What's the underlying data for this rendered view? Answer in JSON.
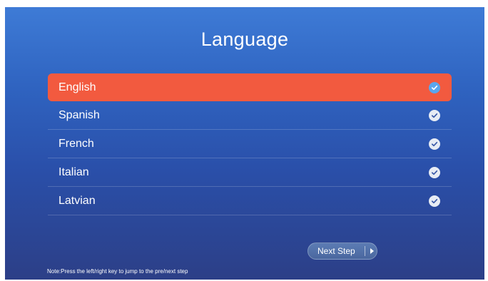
{
  "screen": {
    "title": "Language",
    "languages": [
      {
        "label": "English",
        "selected": true
      },
      {
        "label": "Spanish",
        "selected": false
      },
      {
        "label": "French",
        "selected": false
      },
      {
        "label": "Italian",
        "selected": false
      },
      {
        "label": "Latvian",
        "selected": false
      }
    ],
    "next_button_label": "Next Step",
    "note": "Note:Press the left/right key to jump to the pre/next step"
  },
  "icons": {
    "check": "check-circle-icon",
    "next": "play-arrow-icon"
  },
  "colors": {
    "selected_row": "#f25a3f",
    "selected_check": "#5aa6ee",
    "background_top": "#3e7bd6",
    "background_bottom": "#2c3f87"
  }
}
